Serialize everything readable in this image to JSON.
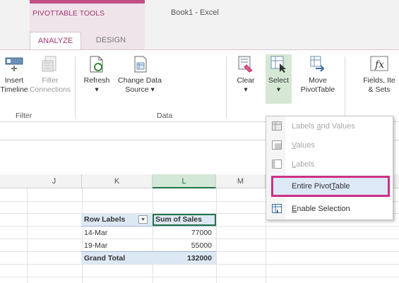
{
  "title_bar": {
    "contextual_group": "PIVOTTABLE TOOLS",
    "workbook_title": "Book1 - Excel"
  },
  "tabs": [
    {
      "label": "ANALYZE",
      "active": true
    },
    {
      "label": "DESIGN",
      "active": false
    }
  ],
  "ribbon": {
    "buttons": [
      {
        "line1": "Insert",
        "line2": "Timeline",
        "icon": "timeline-icon",
        "enabled": true
      },
      {
        "line1": "Filter",
        "line2": "Connections",
        "icon": "filter-connections-icon",
        "enabled": false
      },
      {
        "line1": "Refresh",
        "line2": "▾",
        "icon": "refresh-icon",
        "enabled": true
      },
      {
        "line1": "Change Data",
        "line2": "Source ▾",
        "icon": "change-data-source-icon",
        "enabled": true
      },
      {
        "line1": "Clear",
        "line2": "▾",
        "icon": "clear-icon",
        "enabled": true
      },
      {
        "line1": "Select",
        "line2": "▾",
        "icon": "select-icon",
        "enabled": true,
        "active": true
      },
      {
        "line1": "Move",
        "line2": "PivotTable",
        "icon": "move-pivottable-icon",
        "enabled": true
      },
      {
        "line1": "Fields, Ite",
        "line2": "& Sets",
        "icon": "fx-icon",
        "enabled": true
      }
    ],
    "groups": [
      "Filter",
      "Data"
    ]
  },
  "grid": {
    "column_headers": [
      "J",
      "K",
      "L",
      "M"
    ],
    "selected_column": "L"
  },
  "pivot": {
    "header_row_labels": "Row Labels",
    "header_sum": "Sum of Sales",
    "rows": [
      {
        "label": "14-Mar",
        "value": "77000"
      },
      {
        "label": "19-Mar",
        "value": "55000"
      }
    ],
    "total_label": "Grand Total",
    "total_value": "132000"
  },
  "select_menu": {
    "items": [
      {
        "pre": "Labels ",
        "u": "a",
        "post": "nd Values",
        "enabled": false,
        "icon": "labels-and-values-icon"
      },
      {
        "pre": "",
        "u": "V",
        "post": "alues",
        "enabled": false,
        "icon": "values-icon"
      },
      {
        "pre": "",
        "u": "L",
        "post": "abels",
        "enabled": false,
        "icon": "labels-icon"
      },
      {
        "pre": "Entire Pivot",
        "u": "T",
        "post": "able",
        "enabled": true,
        "highlighted": true,
        "icon": "entire-pivottable-icon"
      },
      {
        "pre": "",
        "u": "E",
        "post": "nable Selection",
        "enabled": true,
        "icon": "enable-selection-icon"
      }
    ]
  },
  "colors": {
    "contextual_accent": "#a23b72",
    "highlight_border": "#cf2f86",
    "excel_green": "#217346"
  }
}
